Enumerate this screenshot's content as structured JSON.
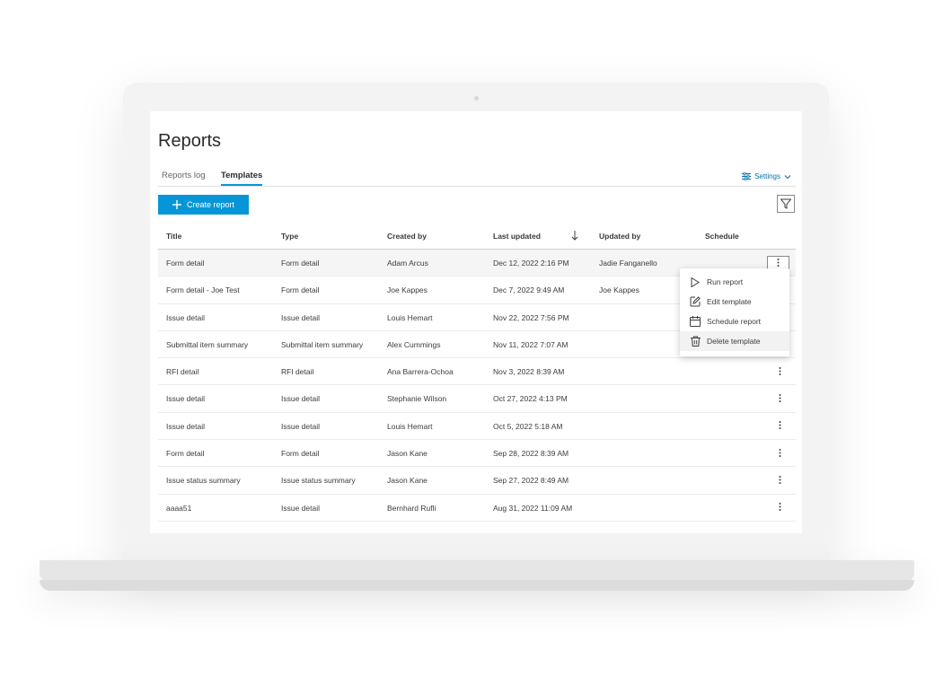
{
  "page": {
    "title": "Reports"
  },
  "tabs": [
    {
      "label": "Reports log"
    },
    {
      "label": "Templates"
    }
  ],
  "settings": {
    "label": "Settings"
  },
  "toolbar": {
    "create_label": "Create report"
  },
  "table": {
    "headers": [
      "Title",
      "Type",
      "Created by",
      "Last updated",
      "Updated by",
      "Schedule"
    ],
    "rows": [
      [
        "Form detail",
        "Form detail",
        "Adam Arcus",
        "Dec 12, 2022 2:16 PM",
        "Jadie Fanganello",
        ""
      ],
      [
        "Form detail - Joe Test",
        "Form detail",
        "Joe Kappes",
        "Dec 7, 2022 9:49 AM",
        "Joe Kappes",
        ""
      ],
      [
        "Issue detail",
        "Issue detail",
        "Louis Hemart",
        "Nov 22, 2022 7:56 PM",
        "",
        ""
      ],
      [
        "Submittal item summary",
        "Submittal item summary",
        "Alex Cummings",
        "Nov 11, 2022 7:07 AM",
        "",
        ""
      ],
      [
        "RFI detail",
        "RFI detail",
        "Ana Barrera-Ochoa",
        "Nov 3, 2022 8:39 AM",
        "",
        ""
      ],
      [
        "Issue detail",
        "Issue detail",
        "Stephanie Wilson",
        "Oct 27, 2022 4:13 PM",
        "",
        ""
      ],
      [
        "Issue detail",
        "Issue detail",
        "Louis Hemart",
        "Oct 5, 2022 5:18 AM",
        "",
        ""
      ],
      [
        "Form detail",
        "Form detail",
        "Jason Kane",
        "Sep 28, 2022 8:39 AM",
        "",
        ""
      ],
      [
        "Issue status summary",
        "Issue status summary",
        "Jason Kane",
        "Sep 27, 2022 8:49 AM",
        "",
        ""
      ],
      [
        "aaaa51",
        "Issue detail",
        "Bernhard Rufli",
        "Aug 31, 2022 11:09 AM",
        "",
        ""
      ]
    ]
  },
  "context_menu": {
    "items": [
      {
        "label": "Run report",
        "icon": "play-icon"
      },
      {
        "label": "Edit template",
        "icon": "edit-icon"
      },
      {
        "label": "Schedule report",
        "icon": "calendar-icon"
      },
      {
        "label": "Delete template",
        "icon": "trash-icon"
      }
    ]
  },
  "colors": {
    "accent": "#0696d7",
    "link": "#0670a8"
  }
}
